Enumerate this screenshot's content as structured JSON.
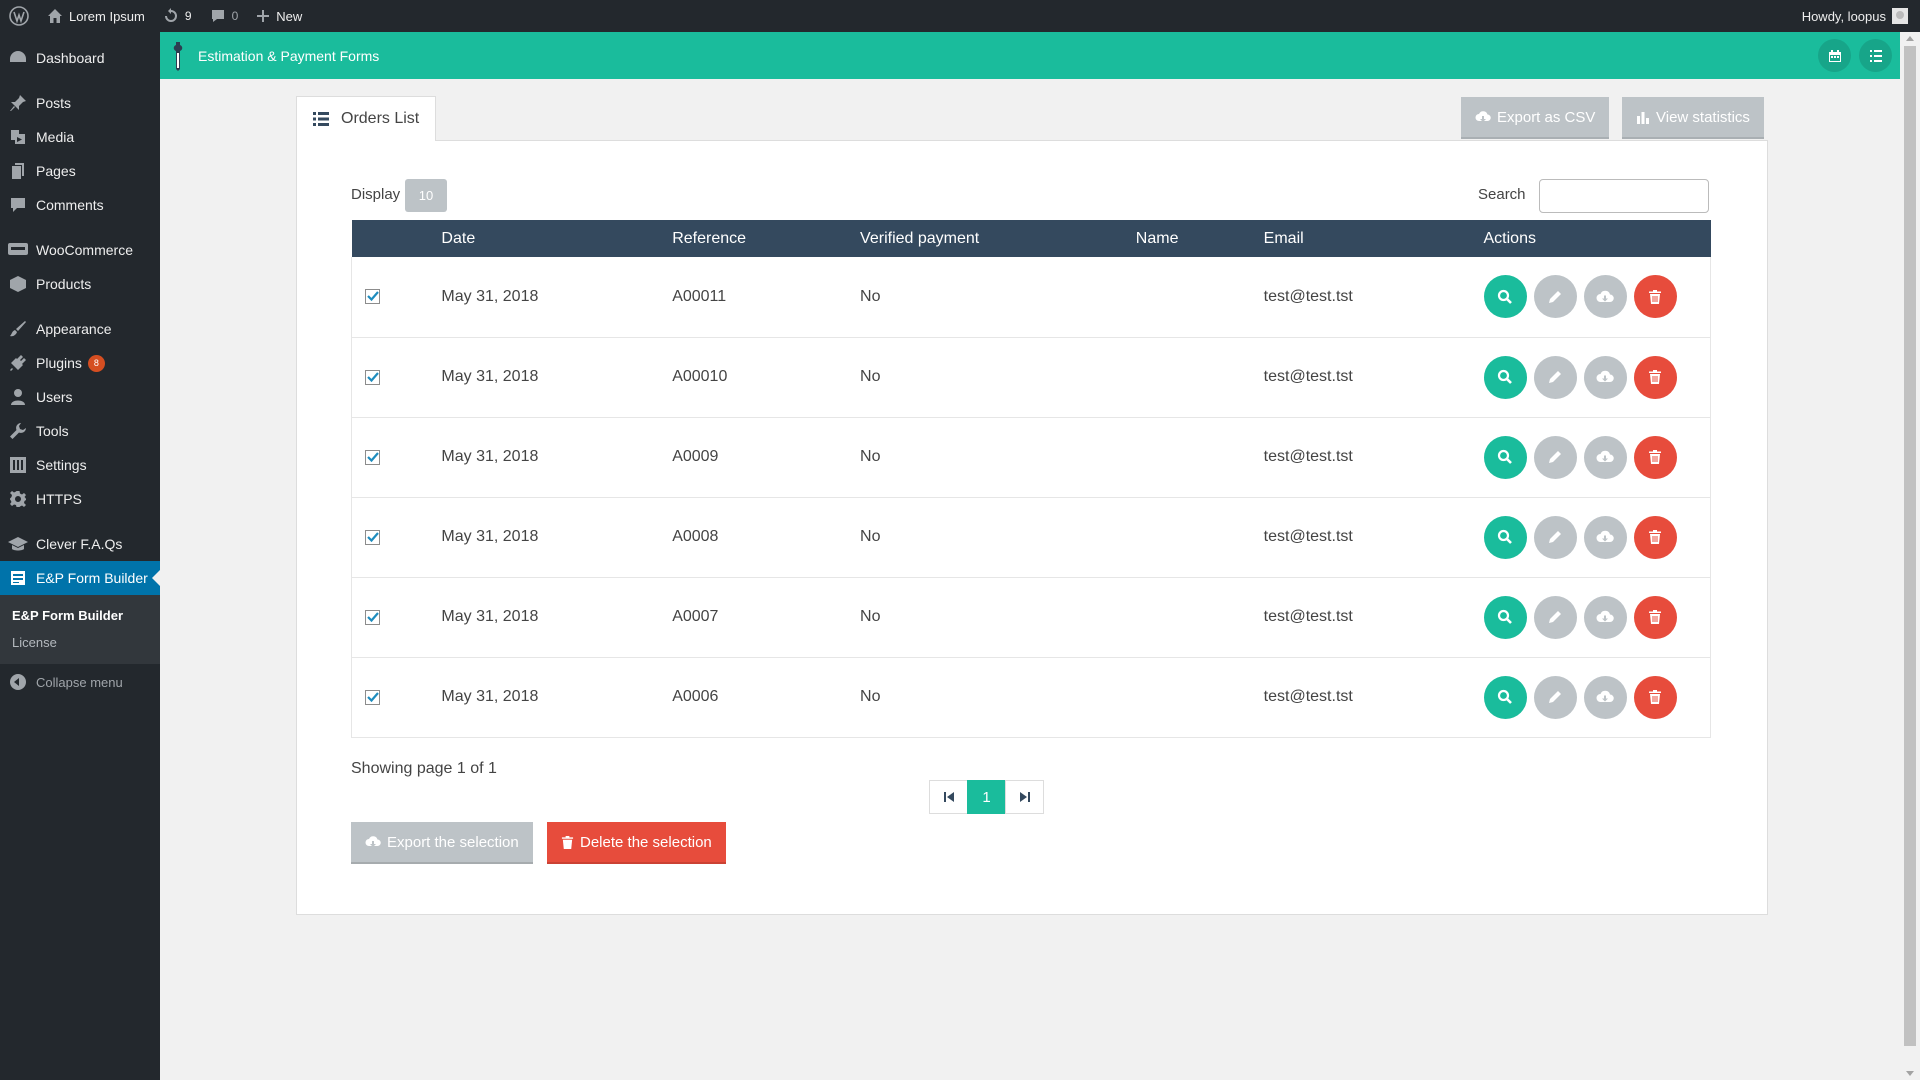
{
  "adminbar": {
    "site_name": "Lorem Ipsum",
    "updates_count": "9",
    "comments_count": "0",
    "new_label": "New",
    "howdy": "Howdy, loopus"
  },
  "menu": {
    "dashboard": "Dashboard",
    "posts": "Posts",
    "media": "Media",
    "pages": "Pages",
    "comments": "Comments",
    "woocommerce": "WooCommerce",
    "products": "Products",
    "appearance": "Appearance",
    "plugins": "Plugins",
    "plugins_badge": "8",
    "users": "Users",
    "tools": "Tools",
    "settings": "Settings",
    "https": "HTTPS",
    "faqs": "Clever F.A.Qs",
    "ep_form_builder": "E&P Form Builder",
    "sub_ep_form_builder": "E&P Form Builder",
    "sub_license": "License",
    "collapse": "Collapse menu"
  },
  "plugin_header": {
    "title": "Estimation & Payment Forms"
  },
  "panel": {
    "tab_label": "Orders List",
    "export_csv": "Export as CSV",
    "view_statistics": "View statistics",
    "display_label": "Display",
    "display_value": "10",
    "search_label": "Search",
    "search_value": ""
  },
  "table": {
    "headers": [
      "Date",
      "Reference",
      "Verified payment",
      "Name",
      "Email",
      "Actions"
    ],
    "rows": [
      {
        "date": "May 31, 2018",
        "reference": "A00011",
        "verified": "No",
        "name": "",
        "email": "test@test.tst"
      },
      {
        "date": "May 31, 2018",
        "reference": "A00010",
        "verified": "No",
        "name": "",
        "email": "test@test.tst"
      },
      {
        "date": "May 31, 2018",
        "reference": "A0009",
        "verified": "No",
        "name": "",
        "email": "test@test.tst"
      },
      {
        "date": "May 31, 2018",
        "reference": "A0008",
        "verified": "No",
        "name": "",
        "email": "test@test.tst"
      },
      {
        "date": "May 31, 2018",
        "reference": "A0007",
        "verified": "No",
        "name": "",
        "email": "test@test.tst"
      },
      {
        "date": "May 31, 2018",
        "reference": "A0006",
        "verified": "No",
        "name": "",
        "email": "test@test.tst"
      }
    ]
  },
  "pagination": {
    "showing": "Showing page 1 of 1",
    "current_page": "1"
  },
  "bottom": {
    "export_selection": "Export the selection",
    "delete_selection": "Delete the selection"
  },
  "colors": {
    "accent": "#1abc9c",
    "table_header": "#34495e",
    "danger": "#e74c3c",
    "muted_button": "#bdc3c7",
    "admin_dark": "#23282d",
    "admin_current": "#0073aa"
  }
}
